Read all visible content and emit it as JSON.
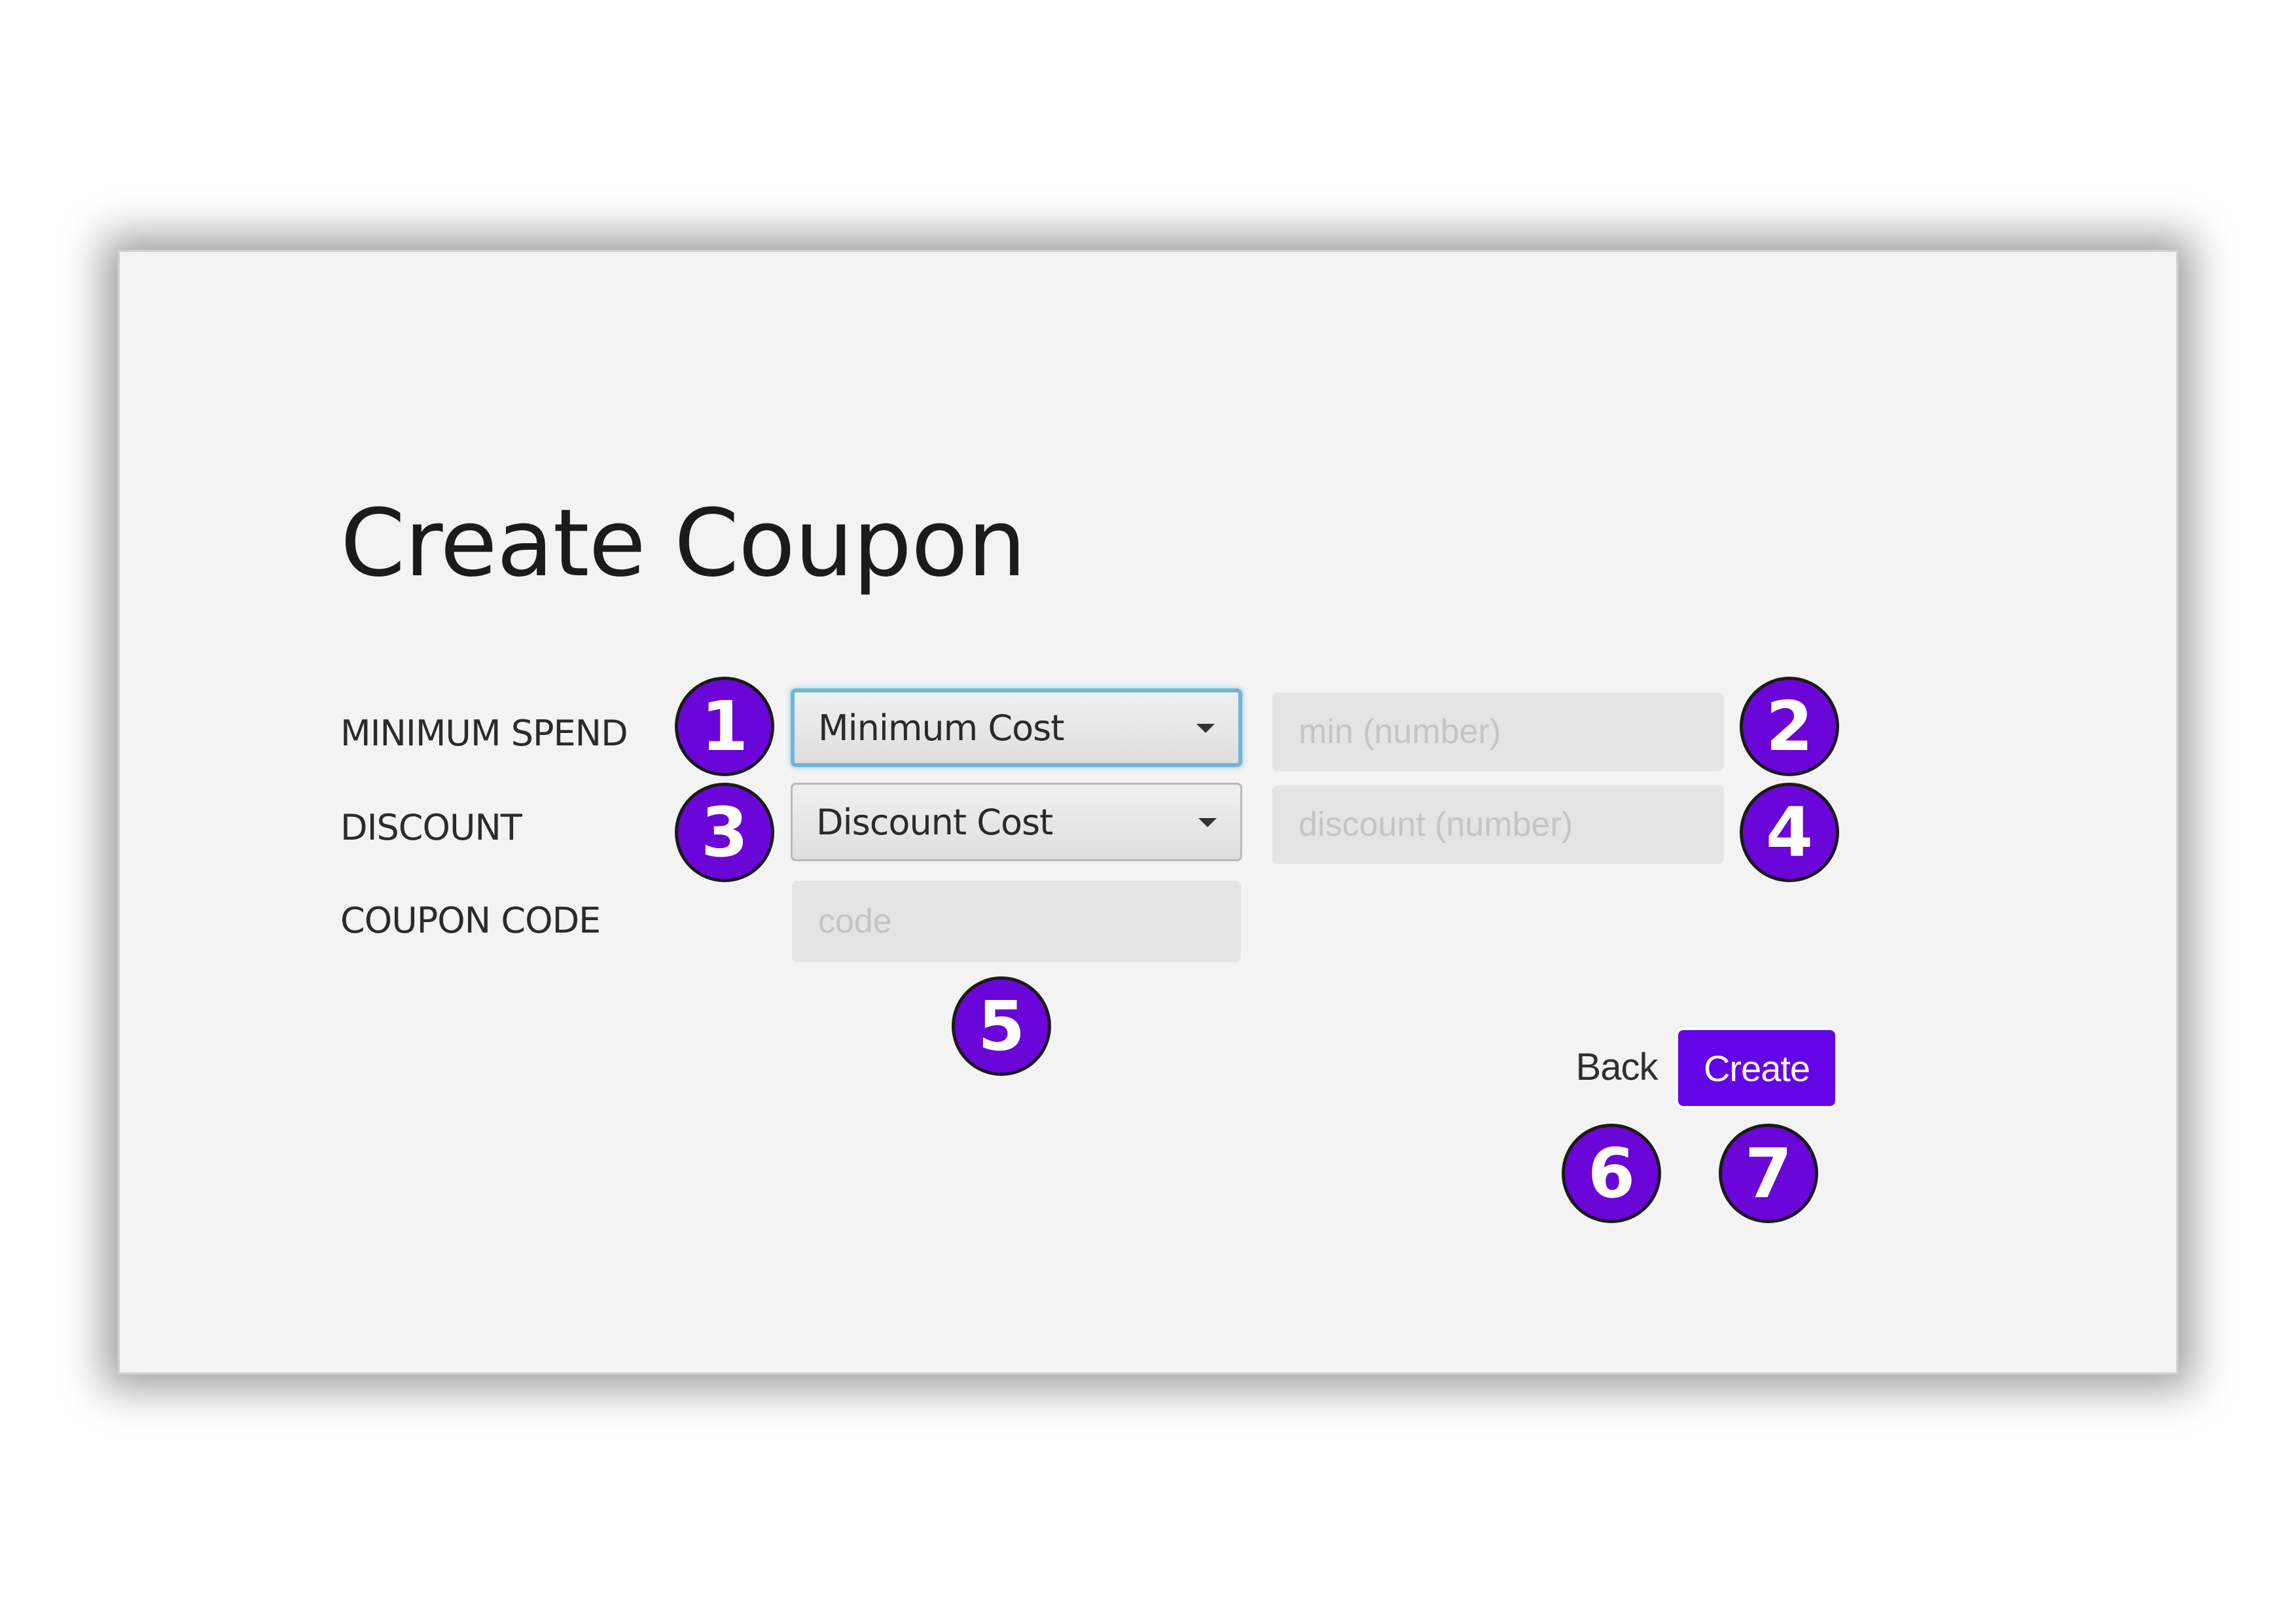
{
  "page": {
    "title": "Create Coupon"
  },
  "form": {
    "minimum_spend": {
      "label": "MINIMUM SPEND",
      "select_value": "Minimum Cost",
      "input_placeholder": "min (number)",
      "input_value": ""
    },
    "discount": {
      "label": "DISCOUNT",
      "select_value": "Discount Cost",
      "input_placeholder": "discount (number)",
      "input_value": ""
    },
    "coupon_code": {
      "label": "COUPON CODE",
      "input_placeholder": "code",
      "input_value": ""
    }
  },
  "actions": {
    "back_label": "Back",
    "create_label": "Create"
  },
  "annotations": [
    "1",
    "2",
    "3",
    "4",
    "5",
    "6",
    "7"
  ],
  "colors": {
    "accent": "#6405e8",
    "badge": "#6a06d8",
    "window_bg": "#f3f3f3",
    "input_bg": "#e4e4e4",
    "focus_ring": "#6fb6d8"
  }
}
